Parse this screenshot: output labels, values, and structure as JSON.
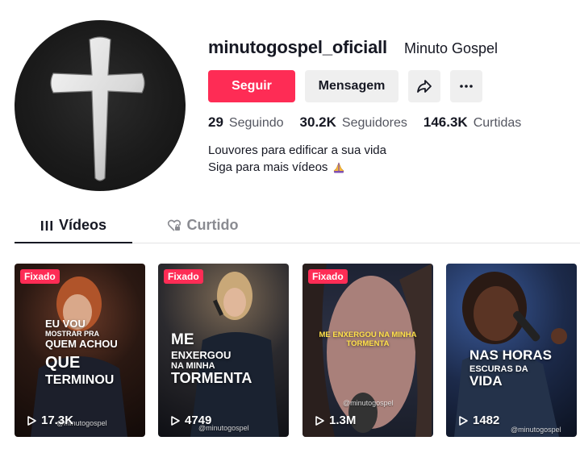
{
  "profile": {
    "username": "minutogospel_oficiall",
    "nickname": "Minuto Gospel",
    "avatar_icon": "cross-icon",
    "bio_line1": "Louvores para edificar a sua vida",
    "bio_line2": "Siga para mais vídeos",
    "bio_emoji": "praying-hands-icon"
  },
  "actions": {
    "follow_label": "Seguir",
    "message_label": "Mensagem",
    "share_icon": "share-icon",
    "more_icon": "more-icon"
  },
  "stats": [
    {
      "value": "29",
      "label": "Seguindo"
    },
    {
      "value": "30.2K",
      "label": "Seguidores"
    },
    {
      "value": "146.3K",
      "label": "Curtidas"
    }
  ],
  "tabs": [
    {
      "label": "Vídeos",
      "icon": "grid-icon",
      "active": true
    },
    {
      "label": "Curtido",
      "icon": "heart-lock-icon",
      "active": false
    }
  ],
  "videos": [
    {
      "pinned_label": "Fixado",
      "caption_lines": [
        "EU VOU",
        "MOSTRAR PRA",
        "QUEM ACHOU",
        "QUE",
        "TERMINOU"
      ],
      "views": "17.3K",
      "watermark": "@minutogospel"
    },
    {
      "pinned_label": "Fixado",
      "caption_lines": [
        "ME",
        "ENXERGOU",
        "NA MINHA",
        "TORMENTA"
      ],
      "views": "4749",
      "watermark": "@minutogospel"
    },
    {
      "pinned_label": "Fixado",
      "caption_lines": [
        "ME ENXERGOU NA MINHA",
        "TORMENTA"
      ],
      "views": "1.3M",
      "watermark": "@minutogospel"
    },
    {
      "pinned_label": "",
      "caption_lines": [
        "NAS HORAS",
        "ESCURAS DA",
        "VIDA"
      ],
      "views": "1482",
      "watermark": "@minutogospel"
    }
  ],
  "colors": {
    "accent": "#fe2c55",
    "text": "#161823",
    "secondary_text": "#545660",
    "button_gray": "#efefef"
  }
}
